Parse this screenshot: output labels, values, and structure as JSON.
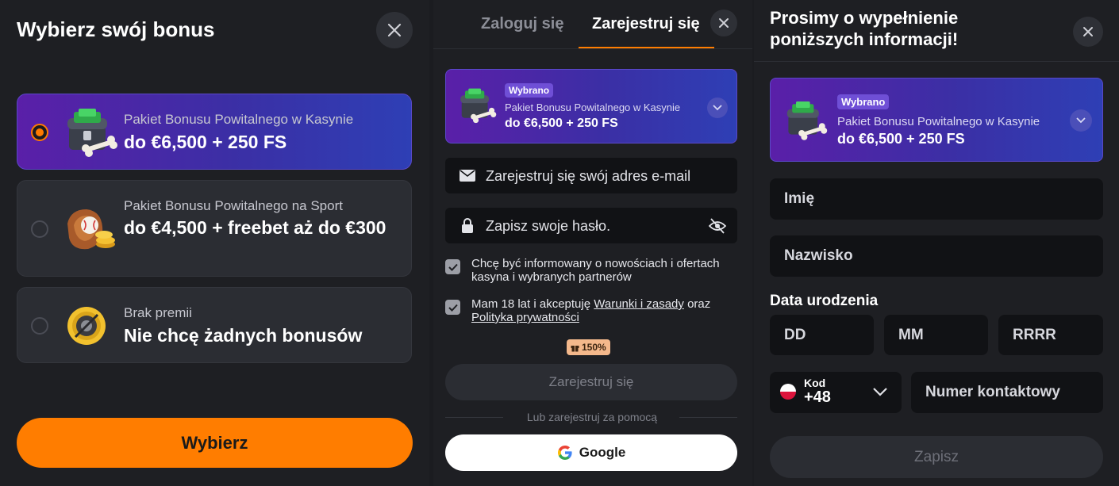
{
  "bonus_select": {
    "title": "Wybierz swój bonus",
    "options": [
      {
        "sub": "Pakiet Bonusu Powitalnego w Kasynie",
        "main": "do €6,500 + 250 FS",
        "icon": "treasure-chest-icon",
        "selected": true
      },
      {
        "sub": "Pakiet Bonusu Powitalnego na Sport",
        "main": "do €4,500 + freebet aż do €300",
        "icon": "baseball-glove-icon",
        "selected": false
      },
      {
        "sub": "Brak premii",
        "main": "Nie chcę żadnych bonusów",
        "icon": "no-bonus-coin-icon",
        "selected": false
      }
    ],
    "choose_label": "Wybierz"
  },
  "register": {
    "tabs": {
      "login": "Zaloguj się",
      "register": "Zarejestruj się"
    },
    "banner": {
      "badge": "Wybrano",
      "sub": "Pakiet Bonusu Powitalnego w Kasynie",
      "main": "do €6,500 + 250 FS"
    },
    "email_placeholder": "Zarejestruj się swój adres e-mail",
    "password_placeholder": "Zapisz swoje hasło.",
    "checkbox_news": "Chcę być informowany o nowościach i ofertach kasyna i wybranych partnerów",
    "checkbox_terms_prefix": "Mam 18 lat i akceptuję ",
    "checkbox_terms_link": "Warunki i zasady",
    "checkbox_terms_mid": " oraz ",
    "checkbox_terms_link2": "Polityka prywatności",
    "promo_badge": "150%",
    "register_button": "Zarejestruj się",
    "or_text": "Lub zarejestruj za pomocą",
    "google_button": "Google"
  },
  "details": {
    "title": "Prosimy o wypełnienie poniższych informacji!",
    "banner": {
      "badge": "Wybrano",
      "sub": "Pakiet Bonusu Powitalnego w Kasynie",
      "main": "do €6,500 + 250 FS"
    },
    "first_name": "Imię",
    "last_name": "Nazwisko",
    "dob_label": "Data urodzenia",
    "dob": {
      "day": "DD",
      "month": "MM",
      "year": "RRRR"
    },
    "phone_code_label": "Kod",
    "phone_code": "+48",
    "phone_placeholder": "Numer kontaktowy",
    "save_button": "Zapisz"
  },
  "colors": {
    "accent": "#ff7d00",
    "purple_start": "#5a1fa8",
    "purple_end": "#2e3fb5"
  }
}
